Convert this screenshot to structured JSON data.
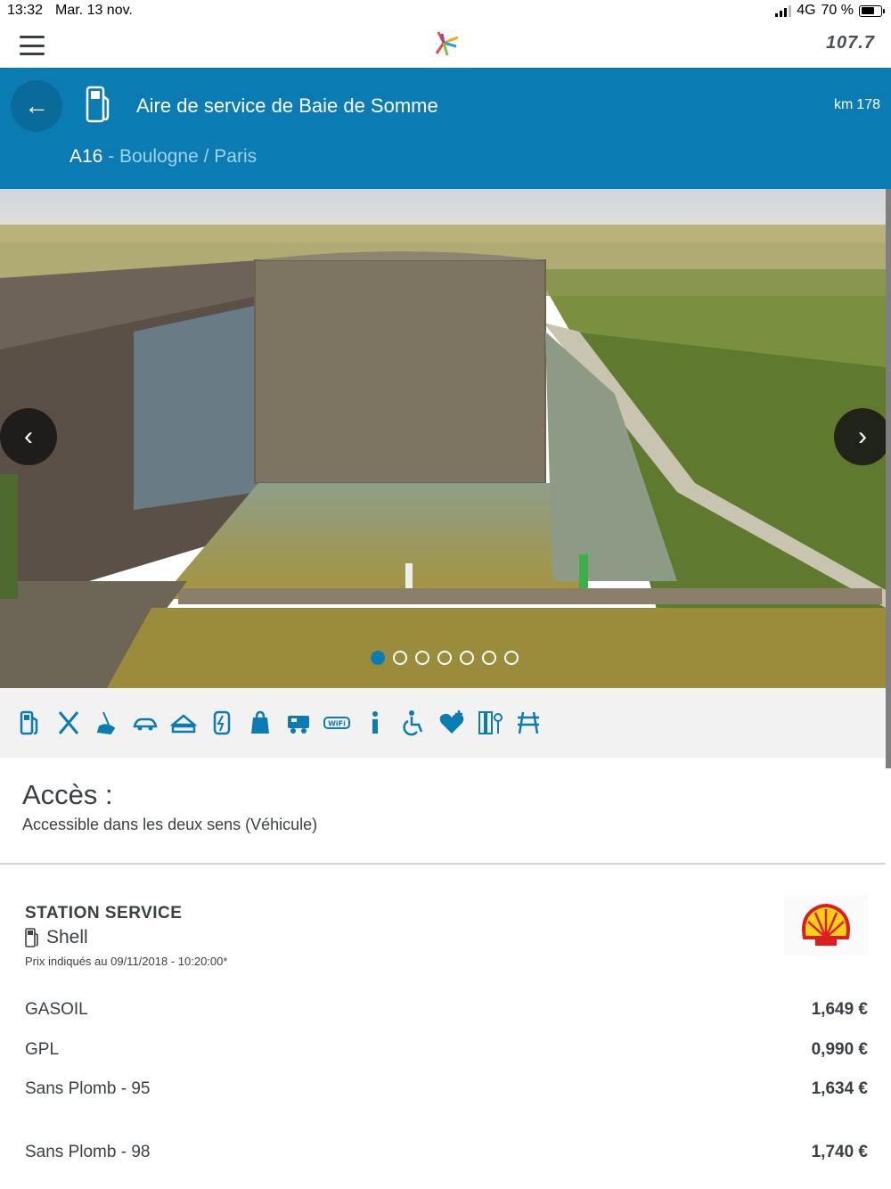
{
  "status_bar": {
    "time": "13:32",
    "date": "Mar. 13 nov.",
    "network": "4G",
    "battery": "70 %"
  },
  "app_bar": {
    "radio_label": "107.7"
  },
  "header": {
    "title": "Aire de service de Baie de Somme",
    "km_label": "km",
    "km_value": "178",
    "road": "A16",
    "direction": " - Boulogne / Paris",
    "color": "#0b7cb3"
  },
  "carousel": {
    "slide_count": 7,
    "active_index": 0
  },
  "services": [
    {
      "name": "fuel-pump-icon"
    },
    {
      "name": "restaurant-icon"
    },
    {
      "name": "cleaning-icon"
    },
    {
      "name": "car-wash-icon"
    },
    {
      "name": "sandwich-icon"
    },
    {
      "name": "ev-charging-icon"
    },
    {
      "name": "shop-icon"
    },
    {
      "name": "camping-car-icon"
    },
    {
      "name": "wifi-icon"
    },
    {
      "name": "info-icon"
    },
    {
      "name": "accessibility-icon"
    },
    {
      "name": "defibrillator-icon"
    },
    {
      "name": "tire-pressure-icon"
    },
    {
      "name": "picnic-icon"
    }
  ],
  "access": {
    "title": "Accès :",
    "text": "Accessible dans les deux sens (Véhicule)"
  },
  "station": {
    "label": "STATION SERVICE",
    "brand": "Shell",
    "price_date": "Prix indiqués au 09/11/2018 - 10:20:00*",
    "fuels": [
      {
        "name": "GASOIL",
        "price": "1,649 €"
      },
      {
        "name": "GPL",
        "price": "0,990 €"
      },
      {
        "name": "Sans Plomb - 95",
        "price": "1,634 €"
      },
      {
        "name": "Sans Plomb - 98",
        "price": "1,740 €"
      }
    ]
  }
}
